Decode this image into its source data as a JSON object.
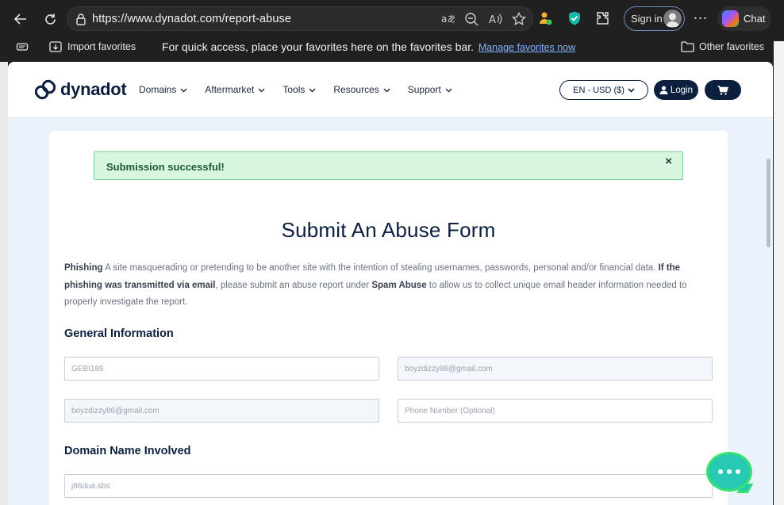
{
  "browser": {
    "url": "https://www.dynadot.com/report-abuse",
    "signin_label": "Sign in",
    "chat_label": "Chat",
    "favorites": {
      "import_label": "Import favorites",
      "message": "For quick access, place your favorites here on the favorites bar.",
      "manage_link": "Manage favorites now",
      "other_label": "Other favorites"
    }
  },
  "site": {
    "logo_text": "dynadot",
    "nav": [
      {
        "label": "Domains"
      },
      {
        "label": "Aftermarket"
      },
      {
        "label": "Tools"
      },
      {
        "label": "Resources"
      },
      {
        "label": "Support"
      }
    ],
    "lang_label": "EN - USD ($)",
    "login_label": "Login"
  },
  "alert": {
    "text": "Submission successful!",
    "close": "×"
  },
  "form": {
    "title": "Submit An Abuse Form",
    "intro": {
      "term": "Phishing",
      "desc": " A site masquerading or pretending to be another site with the intention of stealing usernames, passwords, personal and/or financial data. ",
      "bold2": "If the phishing was transmitted via email",
      "desc2": ", please submit an abuse report under ",
      "bold3": "Spam Abuse",
      "desc3": " to allow us to collect unique email header information needed to properly investigate the report."
    },
    "general_heading": "General Information",
    "fields": {
      "name": "GEBI189",
      "email": "boyzdizzy86@gmail.com",
      "email_confirm": "boyzdizzy86@gmail.com",
      "phone_placeholder": "Phone Number (Optional)"
    },
    "domain_heading": "Domain Name Involved",
    "domain_value": "j86dua.sbs"
  },
  "colors": {
    "brand_navy": "#0c1f3f",
    "success_bg": "#d6f6df",
    "page_bg": "#eaf2fb"
  }
}
